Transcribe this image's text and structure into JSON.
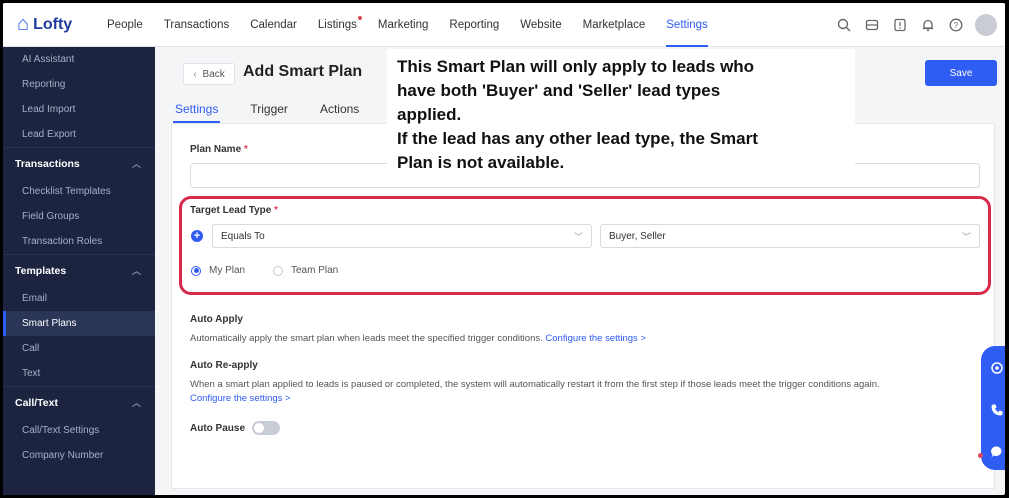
{
  "app": {
    "name": "Lofty"
  },
  "topnav": {
    "items": [
      {
        "label": "People"
      },
      {
        "label": "Transactions"
      },
      {
        "label": "Calendar"
      },
      {
        "label": "Listings"
      },
      {
        "label": "Marketing"
      },
      {
        "label": "Reporting"
      },
      {
        "label": "Website"
      },
      {
        "label": "Marketplace"
      },
      {
        "label": "Settings"
      }
    ],
    "active": "Settings",
    "icons": [
      "search-icon",
      "inbox-icon",
      "notice-icon",
      "bell-icon",
      "help-icon",
      "avatar"
    ]
  },
  "sidebar": {
    "top_items": [
      {
        "label": "AI Assistant"
      },
      {
        "label": "Reporting"
      },
      {
        "label": "Lead Import"
      },
      {
        "label": "Lead Export"
      }
    ],
    "sections": [
      {
        "title": "Transactions",
        "items": [
          {
            "label": "Checklist Templates"
          },
          {
            "label": "Field Groups"
          },
          {
            "label": "Transaction Roles"
          }
        ]
      },
      {
        "title": "Templates",
        "items": [
          {
            "label": "Email"
          },
          {
            "label": "Smart Plans"
          },
          {
            "label": "Call"
          },
          {
            "label": "Text"
          }
        ]
      },
      {
        "title": "Call/Text",
        "items": [
          {
            "label": "Call/Text Settings"
          },
          {
            "label": "Company Number"
          }
        ]
      }
    ],
    "active_item": "Smart Plans"
  },
  "header": {
    "back_label": "Back",
    "title": "Add Smart Plan",
    "save_label": "Save",
    "tabs": [
      {
        "label": "Settings"
      },
      {
        "label": "Trigger"
      },
      {
        "label": "Actions"
      }
    ],
    "active_tab": "Settings"
  },
  "form": {
    "plan_name_label": "Plan Name",
    "required_mark": "*",
    "plan_name_value": "",
    "target_lead_type_label": "Target Lead Type",
    "operator_value": "Equals To",
    "lead_types_value": "Buyer, Seller",
    "plan_scope": [
      {
        "label": "My Plan",
        "checked": true
      },
      {
        "label": "Team Plan",
        "checked": false
      }
    ],
    "auto_apply_label": "Auto Apply",
    "auto_apply_desc": "Automatically apply the smart plan when leads meet the specified trigger conditions.",
    "auto_apply_link": "Configure the settings >",
    "auto_reapply_label": "Auto Re-apply",
    "auto_reapply_desc": "When a smart plan applied to leads is paused or completed, the system will automatically restart it from the first step if those leads meet the trigger conditions again.",
    "auto_reapply_link": "Configure the settings >",
    "auto_pause_label": "Auto Pause",
    "auto_pause_on": false
  },
  "annotation": {
    "lines": [
      "This Smart Plan will only apply to leads who",
      "have both 'Buyer' and 'Seller' lead types",
      "applied.",
      "If the lead has any other lead type, the Smart",
      "Plan is not available."
    ],
    "highlight_color": "#d9294a"
  },
  "float_widget": {
    "icons": [
      "headset-icon",
      "phone-icon",
      "chat-icon"
    ]
  },
  "colors": {
    "accent": "#2f5cf2",
    "sidebar_bg": "#1c2440"
  }
}
